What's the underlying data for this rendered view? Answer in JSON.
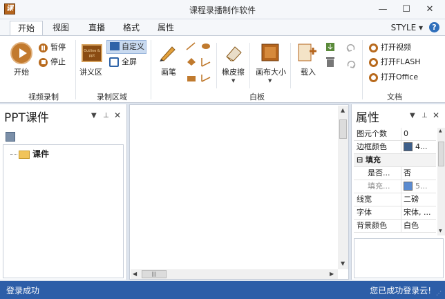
{
  "window": {
    "title": "课程录播制作软件",
    "app_icon_glyph": "课",
    "minimize": "—",
    "maximize": "☐",
    "close": "✕"
  },
  "ribbon_tabs": {
    "items": [
      {
        "label": "开始",
        "active": true
      },
      {
        "label": "视图",
        "active": false
      },
      {
        "label": "直播",
        "active": false
      },
      {
        "label": "格式",
        "active": false
      },
      {
        "label": "属性",
        "active": false
      }
    ],
    "style_label": "STYLE ▾",
    "help": "?"
  },
  "ribbon": {
    "video_group": {
      "label": "视频录制",
      "start": "开始",
      "pause": "暂停",
      "stop": "停止"
    },
    "area_group": {
      "label": "录制区域",
      "lecture": "讲义区",
      "lecture_thumb": "Outline & ppt",
      "custom": "自定义",
      "fullscreen": "全屏"
    },
    "whiteboard_group": {
      "label": "白板",
      "pen": "画笔",
      "eraser": "橡皮擦",
      "canvas_size": "画布大小",
      "load": "载入"
    },
    "document_group": {
      "label": "文档",
      "open_video": "打开视频",
      "open_flash": "打开FLASH",
      "open_office": "打开Office"
    }
  },
  "left_panel": {
    "title": "PPT课件",
    "tree": [
      {
        "label": "课件"
      }
    ]
  },
  "right_panel": {
    "title": "属性",
    "properties": [
      {
        "name": "图元个数",
        "value": "0"
      },
      {
        "name": "边框颜色",
        "value": "4...",
        "swatch": "#3e5f8a"
      },
      {
        "name": "⊟  填充",
        "value": "",
        "category": true
      },
      {
        "name": "是否...",
        "value": "否",
        "indent": true
      },
      {
        "name": "填充...",
        "value": "5...",
        "swatch": "#5b8bd0",
        "indent": true,
        "dim": true
      },
      {
        "name": "线宽",
        "value": "二磅"
      },
      {
        "name": "字体",
        "value": "宋体, ..."
      },
      {
        "name": "背景颜色",
        "value": "白色"
      }
    ]
  },
  "status": {
    "left": "登录成功",
    "right": "您已成功登录云!"
  },
  "colors": {
    "accent": "#2d5ea8",
    "ribbon_icon": "#b86a1d",
    "selected": "#c9daf0"
  }
}
